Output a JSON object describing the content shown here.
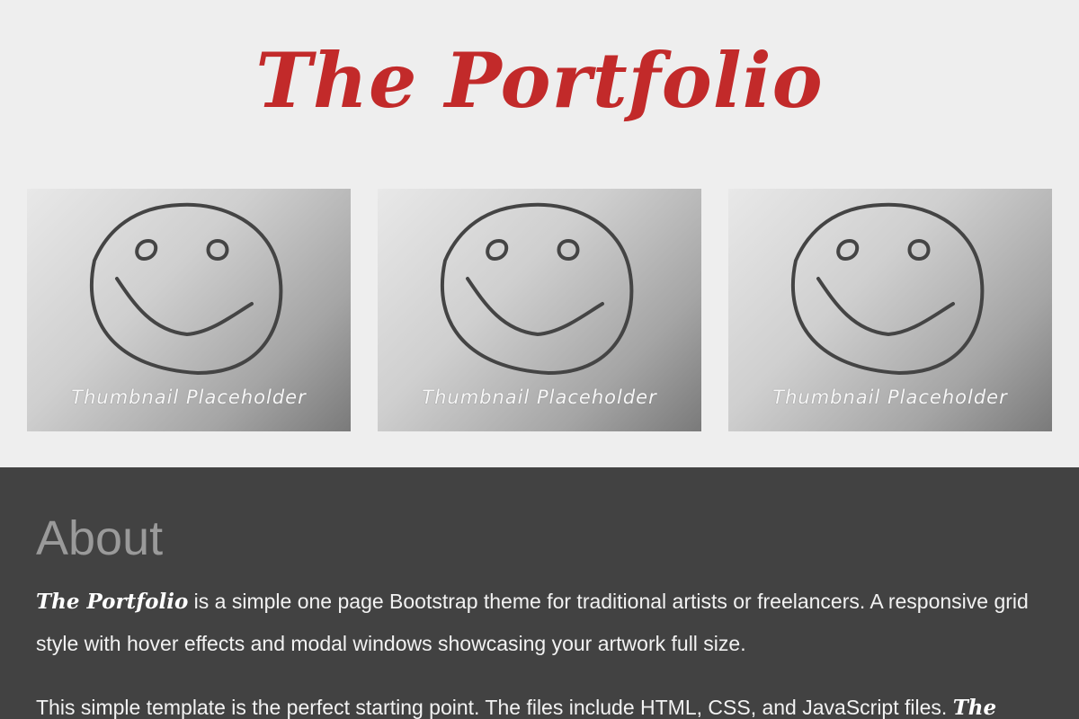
{
  "header": {
    "title": "The Portfolio",
    "title_color": "#c22a2a"
  },
  "thumbnails": [
    {
      "caption": "Thumbnail Placeholder",
      "icon": "smiley-face-icon"
    },
    {
      "caption": "Thumbnail Placeholder",
      "icon": "smiley-face-icon"
    },
    {
      "caption": "Thumbnail Placeholder",
      "icon": "smiley-face-icon"
    }
  ],
  "about": {
    "heading": "About",
    "p1_brand": "The Portfolio",
    "p1_text": " is a simple one page Bootstrap theme for traditional artists or freelancers. A responsive grid style with hover effects and modal windows showcasing your artwork full size.",
    "p2_text": "This simple template is the perfect starting point. The files include HTML, CSS, and JavaScript files. ",
    "p2_brand": "The",
    "background": "#424242"
  }
}
